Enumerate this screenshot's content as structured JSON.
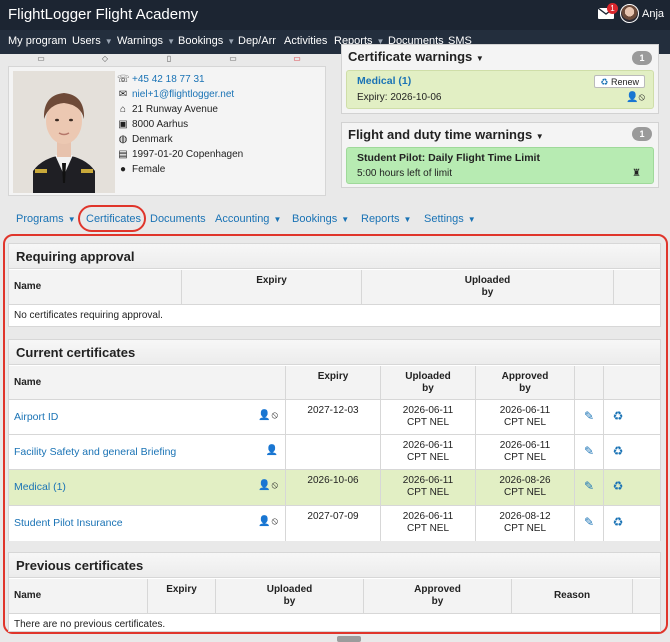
{
  "app": {
    "title": "FlightLogger Flight Academy",
    "mail_badge": "1",
    "user_name": "Anja"
  },
  "nav": [
    {
      "label": "My program",
      "caret": false
    },
    {
      "label": "Users",
      "caret": true
    },
    {
      "label": "Warnings",
      "caret": true
    },
    {
      "label": "Bookings",
      "caret": true
    },
    {
      "label": "Dep/Arr",
      "caret": false
    },
    {
      "label": "Activities",
      "caret": false
    },
    {
      "label": "Reports",
      "caret": true
    },
    {
      "label": "Documents",
      "caret": false
    },
    {
      "label": "SMS",
      "caret": false
    }
  ],
  "profile": {
    "phone": "+45 42 18 77 31",
    "email": "niel+1@flightlogger.net",
    "street": "21 Runway Avenue",
    "city": "8000 Aarhus",
    "country": "Denmark",
    "birth": "1997-01-20 Copenhagen",
    "gender": "Female"
  },
  "certificate_warnings": {
    "title": "Certificate warnings",
    "count": "1",
    "item_title": "Medical (1)",
    "item_detail": "Expiry: 2026-10-06",
    "renew_label": "Renew"
  },
  "duty_warnings": {
    "title": "Flight and duty time warnings",
    "count": "1",
    "item_title": "Student Pilot: Daily Flight Time Limit",
    "item_detail": "5:00 hours left of limit"
  },
  "subtabs": [
    {
      "label": "Programs",
      "caret": true
    },
    {
      "label": "Certificates",
      "caret": false
    },
    {
      "label": "Documents",
      "caret": false
    },
    {
      "label": "Accounting",
      "caret": true
    },
    {
      "label": "Bookings",
      "caret": true
    },
    {
      "label": "Reports",
      "caret": true
    },
    {
      "label": "Settings",
      "caret": true
    }
  ],
  "requiring_approval": {
    "title": "Requiring approval",
    "headers": {
      "name": "Name",
      "expiry": "Expiry",
      "uploaded_line1": "Uploaded",
      "uploaded_line2": "by"
    },
    "empty": "No certificates requiring approval."
  },
  "current": {
    "title": "Current certificates",
    "headers": {
      "name": "Name",
      "expiry": "Expiry",
      "uploaded_line1": "Uploaded",
      "uploaded_line2": "by",
      "approved_line1": "Approved",
      "approved_line2": "by"
    },
    "rows": [
      {
        "name": "Airport ID",
        "icons": "👤⦸",
        "expiry": "2027-12-03",
        "uploaded_date": "2026-06-11",
        "uploaded_by": "CPT NEL",
        "approved_date": "2026-06-11",
        "approved_by": "CPT NEL",
        "highlight": false
      },
      {
        "name": "Facility Safety and general Briefing",
        "icons": "👤",
        "expiry": "",
        "uploaded_date": "2026-06-11",
        "uploaded_by": "CPT NEL",
        "approved_date": "2026-06-11",
        "approved_by": "CPT NEL",
        "highlight": false
      },
      {
        "name": "Medical (1)",
        "icons": "👤⦸",
        "expiry": "2026-10-06",
        "uploaded_date": "2026-06-11",
        "uploaded_by": "CPT NEL",
        "approved_date": "2026-08-26",
        "approved_by": "CPT NEL",
        "highlight": true
      },
      {
        "name": "Student Pilot Insurance",
        "icons": "👤⦸",
        "expiry": "2027-07-09",
        "uploaded_date": "2026-06-11",
        "uploaded_by": "CPT NEL",
        "approved_date": "2026-08-12",
        "approved_by": "CPT NEL",
        "highlight": false
      }
    ]
  },
  "previous": {
    "title": "Previous certificates",
    "headers": {
      "name": "Name",
      "expiry": "Expiry",
      "uploaded_line1": "Uploaded",
      "uploaded_line2": "by",
      "approved_line1": "Approved",
      "approved_line2": "by",
      "reason": "Reason"
    },
    "empty": "There are no previous certificates."
  },
  "colors": {
    "accent": "#1a73b5",
    "highlight": "#e0352b",
    "nav_bg": "#232e3d",
    "warn_green": "#b7ebb2",
    "warn_yellow": "#e2efc4"
  },
  "icons": {
    "edit": "pencil-icon",
    "renew": "recycle-icon",
    "user": "person-icon",
    "no": "prohibited-icon"
  }
}
